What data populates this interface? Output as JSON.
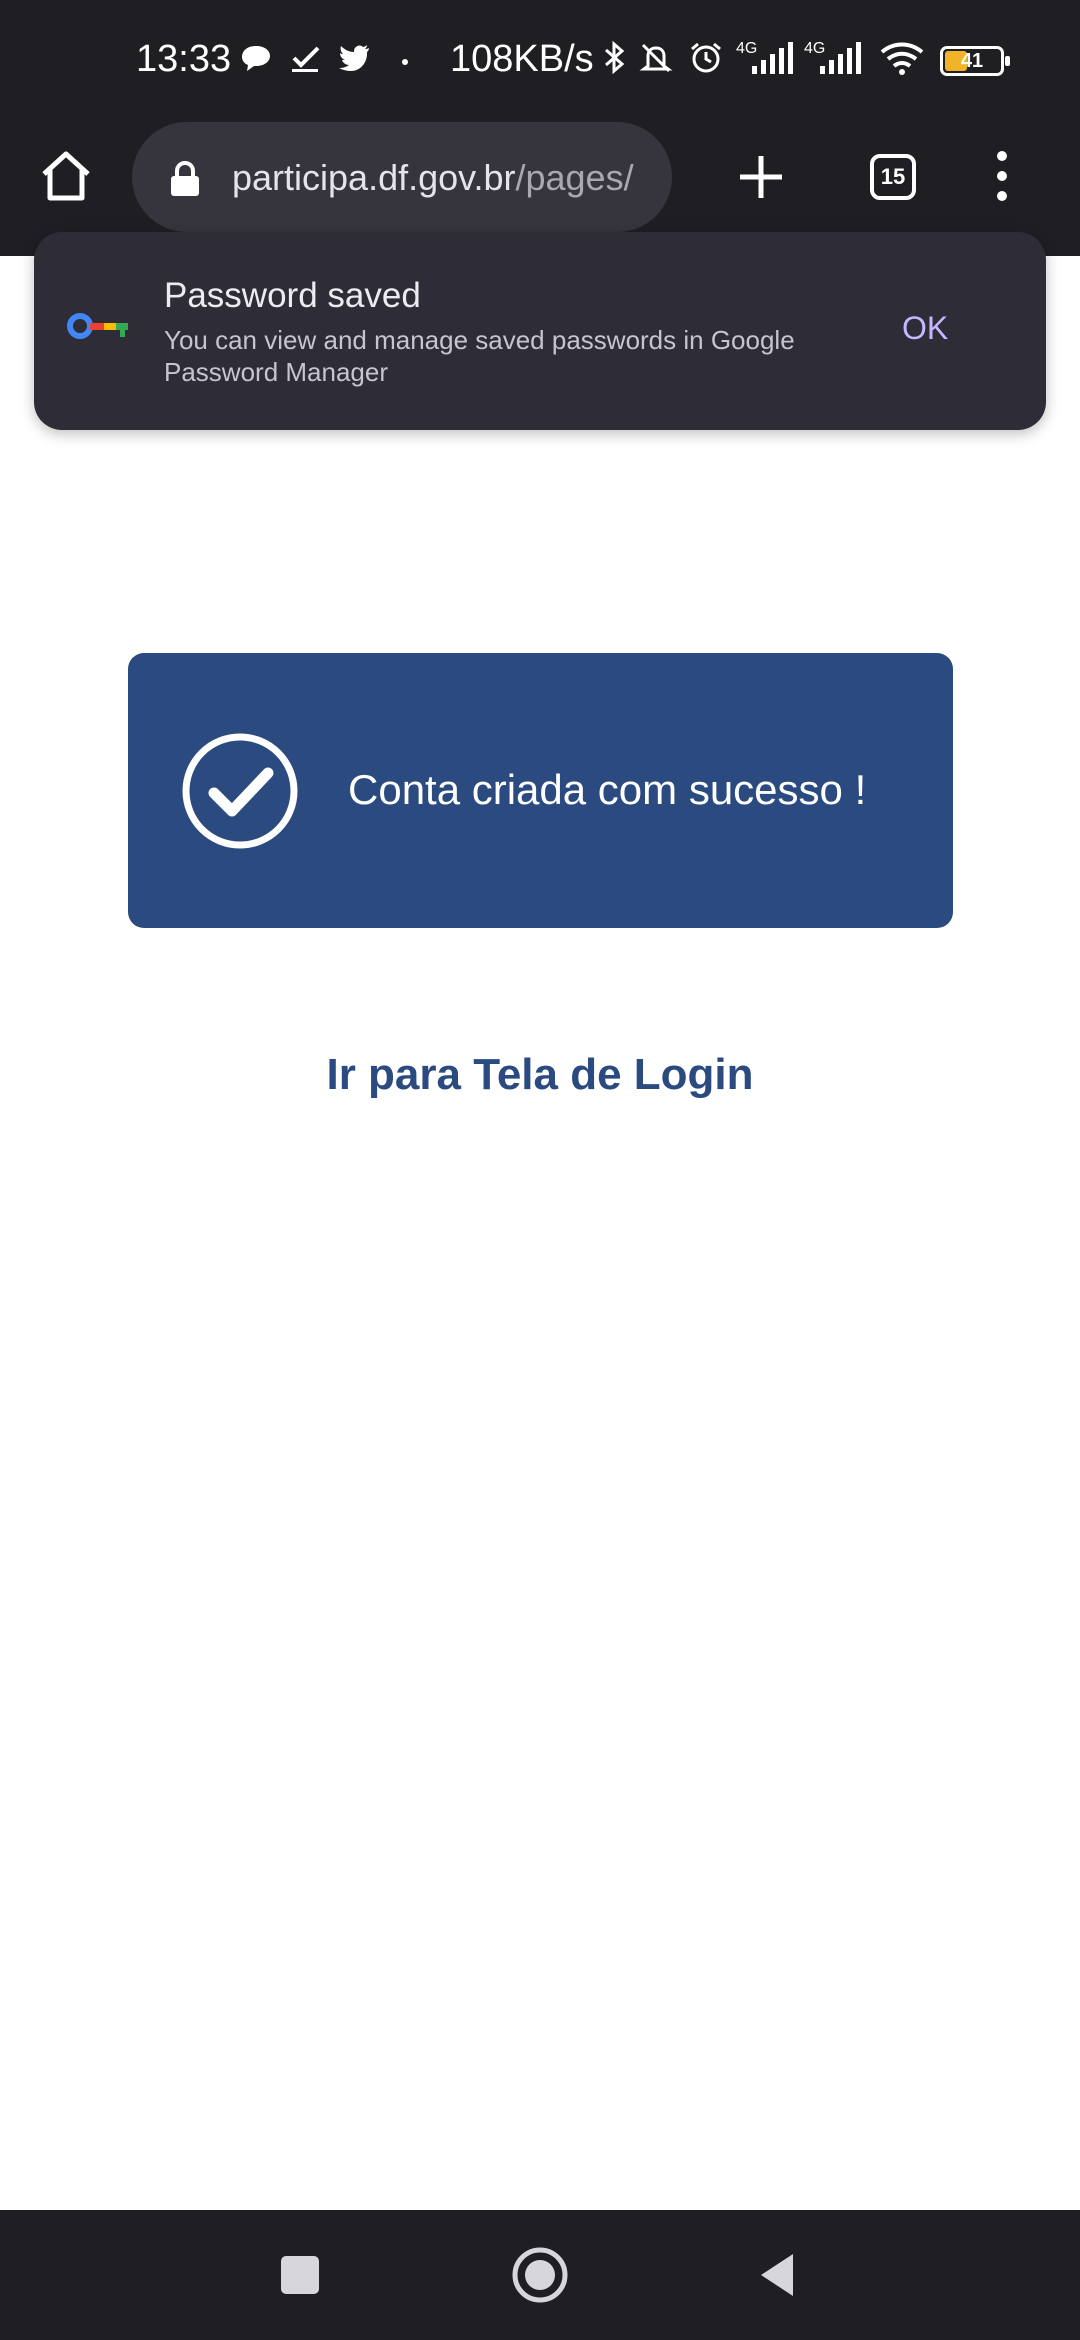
{
  "status_bar": {
    "time": "13:33",
    "net_speed": "108KB/s",
    "sim1_label": "4G",
    "sim2_label": "4G",
    "battery_level": "41",
    "icons": [
      "chat-bubble-icon",
      "check-icon",
      "twitter-icon",
      "dot-icon",
      "bluetooth-icon",
      "bell-off-icon",
      "alarm-icon",
      "signal-icon",
      "signal-icon",
      "wifi-icon",
      "battery-icon"
    ]
  },
  "browser": {
    "url_host": "participa.df.gov.br",
    "url_path": "/pages/",
    "tab_count": "15",
    "icons": [
      "home-icon",
      "lock-icon",
      "plus-icon",
      "tabs-icon",
      "more-vert-icon"
    ]
  },
  "snackbar": {
    "title": "Password saved",
    "body": "You can view and manage saved passwords in Google Password Manager",
    "ok_label": "OK",
    "icon": "password-key-icon"
  },
  "main": {
    "success_message": "Conta criada com sucesso !",
    "login_link": "Ir para Tela de Login"
  },
  "colors": {
    "primary": "#2a4a80",
    "chrome_bg": "#1f1f23",
    "snackbar_bg": "#2e2c36",
    "ok_accent": "#c7b7ff"
  },
  "nav": {
    "icons": [
      "recents-square-icon",
      "home-circle-icon",
      "back-triangle-icon"
    ]
  }
}
